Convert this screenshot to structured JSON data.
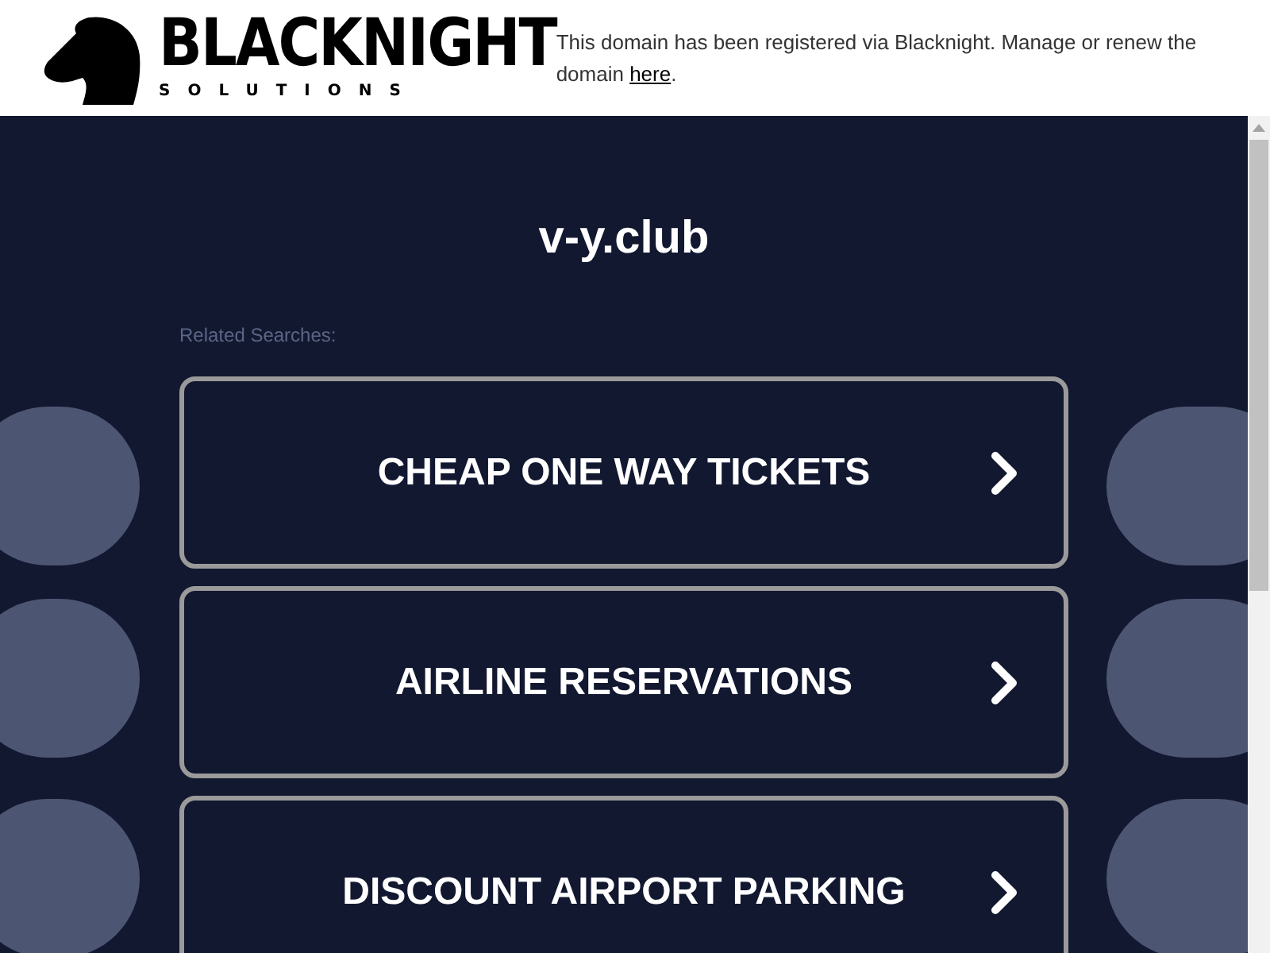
{
  "logo": {
    "name": "BLACKNIGHT",
    "tagline": "SOLUTIONS"
  },
  "notice": {
    "text": "This domain has been registered via Blacknight. Manage or renew the domain ",
    "link": "here",
    "end": "."
  },
  "domain": "v-y.club",
  "related_label": "Related Searches:",
  "links": [
    {
      "label": "CHEAP ONE WAY TICKETS"
    },
    {
      "label": "AIRLINE RESERVATIONS"
    },
    {
      "label": "DISCOUNT AIRPORT PARKING"
    }
  ]
}
